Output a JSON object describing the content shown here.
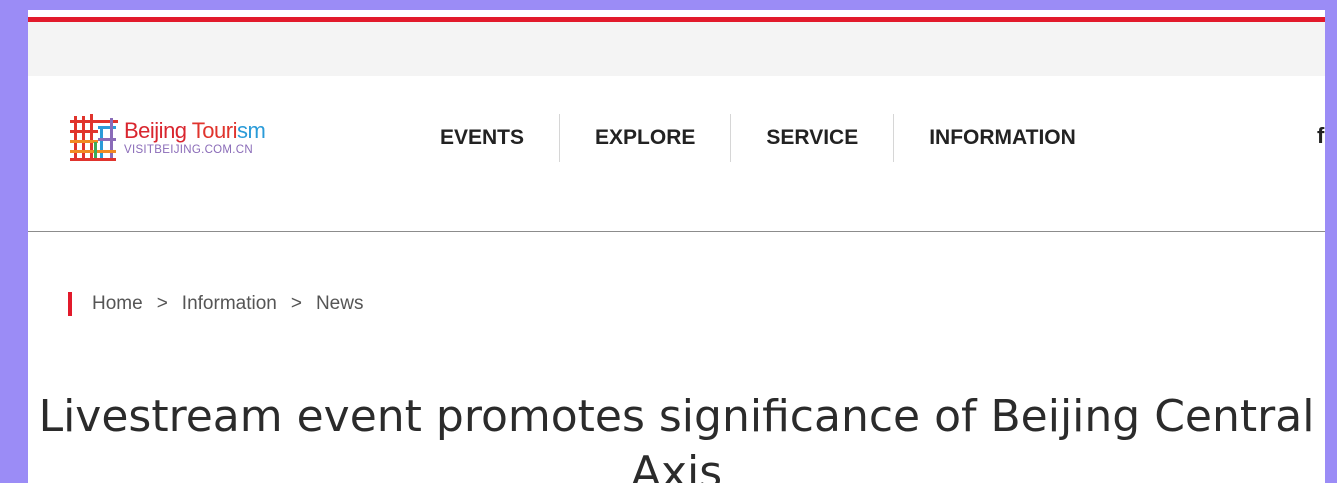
{
  "brand": {
    "name_part1": "Beijing ",
    "name_part2": "Touri",
    "name_part3": "sm",
    "subtitle": "VISITBEIJING.COM.CN",
    "logo_icon": "beijing-tourism-logo-icon"
  },
  "nav": {
    "items": [
      {
        "label": "EVENTS"
      },
      {
        "label": "EXPLORE"
      },
      {
        "label": "SERVICE"
      },
      {
        "label": "INFORMATION"
      }
    ],
    "social_icon": "facebook-icon",
    "social_glyph": "f"
  },
  "breadcrumb": {
    "items": [
      "Home",
      "Information",
      "News"
    ],
    "separator": ">"
  },
  "article": {
    "title": "Livestream event promotes significance of Beijing Central Axis"
  },
  "colors": {
    "frame": "#9b8cf6",
    "accent_red": "#e21a2b",
    "text_dark": "#222222"
  }
}
